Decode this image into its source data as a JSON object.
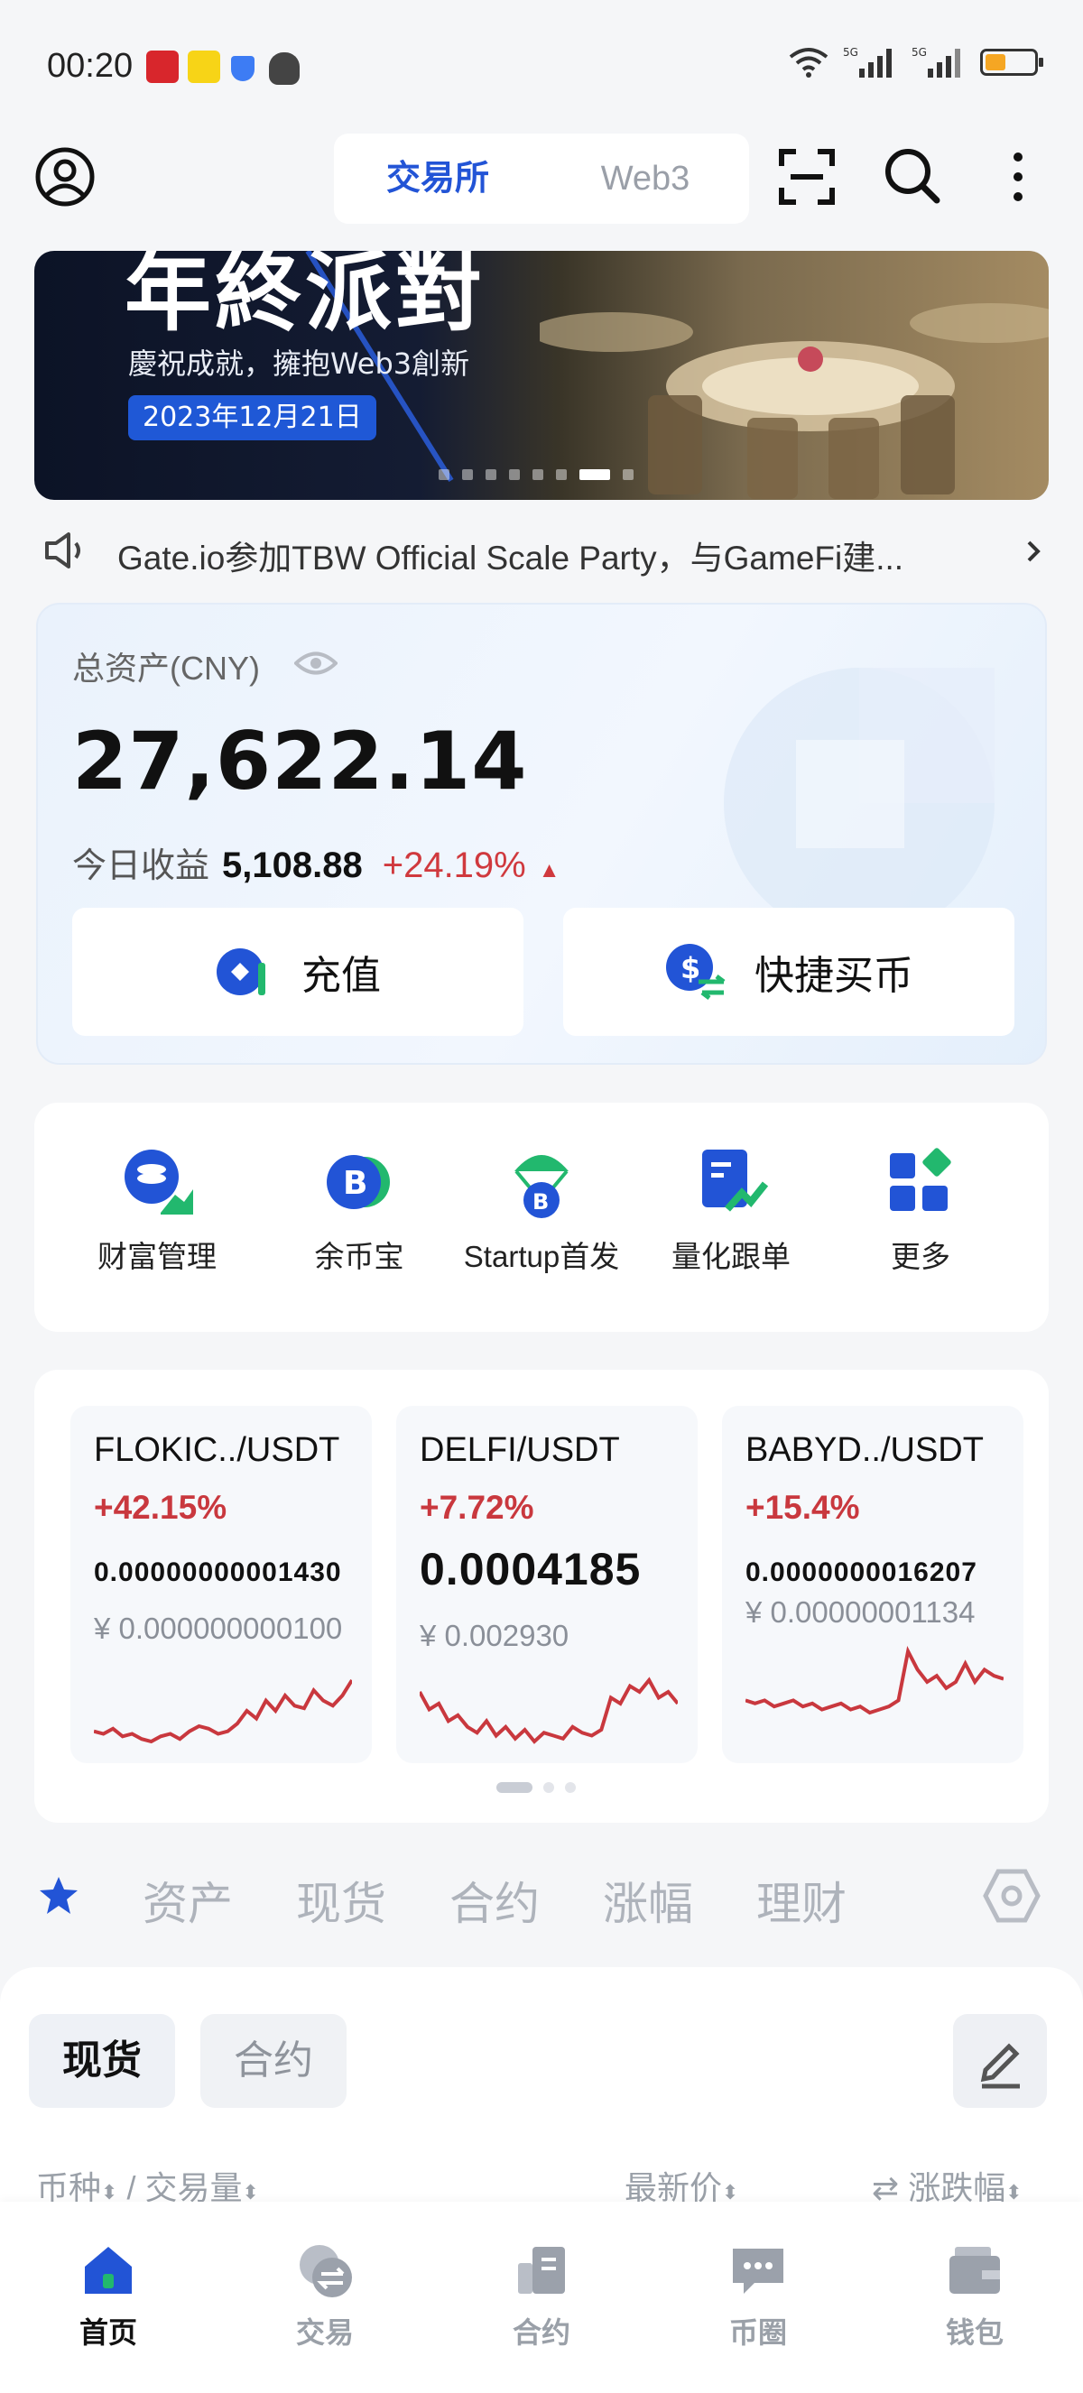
{
  "status_bar": {
    "time": "00:20"
  },
  "header": {
    "tabs": [
      {
        "label": "交易所",
        "active": true
      },
      {
        "label": "Web3",
        "active": false
      }
    ]
  },
  "banner": {
    "title": "年終派對",
    "subtitle": "慶祝成就，擁抱Web3創新",
    "date": "2023年12月21日",
    "dots_count": 8,
    "active_dot": 6
  },
  "announcement": {
    "text": "Gate.io参加TBW Official Scale Party，与GameFi建..."
  },
  "assets": {
    "label": "总资产(CNY)",
    "total": "27,622.14",
    "today_label": "今日收益",
    "today_profit": "5,108.88",
    "today_pct": "+24.19%",
    "deposit_label": "充值",
    "quick_buy_label": "快捷买币"
  },
  "quick_menu": [
    {
      "label": "财富管理",
      "icon": "wealth-management-icon"
    },
    {
      "label": "余币宝",
      "icon": "bitcoin-savings-icon"
    },
    {
      "label": "Startup首发",
      "icon": "startup-launch-icon"
    },
    {
      "label": "量化跟单",
      "icon": "quant-copy-icon"
    },
    {
      "label": "更多",
      "icon": "more-apps-icon"
    }
  ],
  "markets": [
    {
      "pair": "FLOKIC../USDT",
      "change": "+42.15%",
      "price": "0.00000000001430",
      "cny": "¥ 0.000000000100",
      "spark": [
        10,
        9,
        11,
        8,
        9,
        7,
        6,
        8,
        9,
        7,
        10,
        12,
        11,
        9,
        10,
        13,
        18,
        15,
        22,
        18,
        24,
        20,
        19,
        26,
        22,
        20,
        24,
        30
      ]
    },
    {
      "pair": "DELFI/USDT",
      "change": "+7.72%",
      "price": "0.0004185",
      "cny": "¥ 0.002930",
      "spark": [
        24,
        18,
        20,
        14,
        16,
        12,
        10,
        14,
        9,
        12,
        8,
        11,
        7,
        10,
        9,
        8,
        12,
        10,
        9,
        11,
        22,
        20,
        26,
        24,
        28,
        22,
        24,
        20
      ]
    },
    {
      "pair": "BABYD../USDT",
      "change": "+15.4%",
      "price": "0.0000000016207",
      "cny": "¥ 0.00000001134",
      "spark": [
        12,
        11,
        12,
        10,
        11,
        12,
        10,
        11,
        9,
        10,
        11,
        9,
        10,
        8,
        9,
        10,
        12,
        28,
        22,
        18,
        20,
        16,
        18,
        24,
        18,
        22,
        20,
        19
      ]
    }
  ],
  "market_dots": 3,
  "categories": [
    "资产",
    "现货",
    "合约",
    "涨幅",
    "理财"
  ],
  "list": {
    "tabs": [
      "现货",
      "合约"
    ],
    "col_pair": "币种",
    "col_sep": "/",
    "col_volume": "交易量",
    "col_price": "最新价",
    "col_change": "涨跌幅"
  },
  "bottom_nav": [
    {
      "label": "首页",
      "icon": "home-icon",
      "active": true
    },
    {
      "label": "交易",
      "icon": "trade-icon",
      "active": false
    },
    {
      "label": "合约",
      "icon": "futures-icon",
      "active": false
    },
    {
      "label": "币圈",
      "icon": "community-icon",
      "active": false
    },
    {
      "label": "钱包",
      "icon": "wallet-icon",
      "active": false
    }
  ],
  "colors": {
    "accent": "#2254d6",
    "up": "#c9383e",
    "green": "#22b86e"
  }
}
